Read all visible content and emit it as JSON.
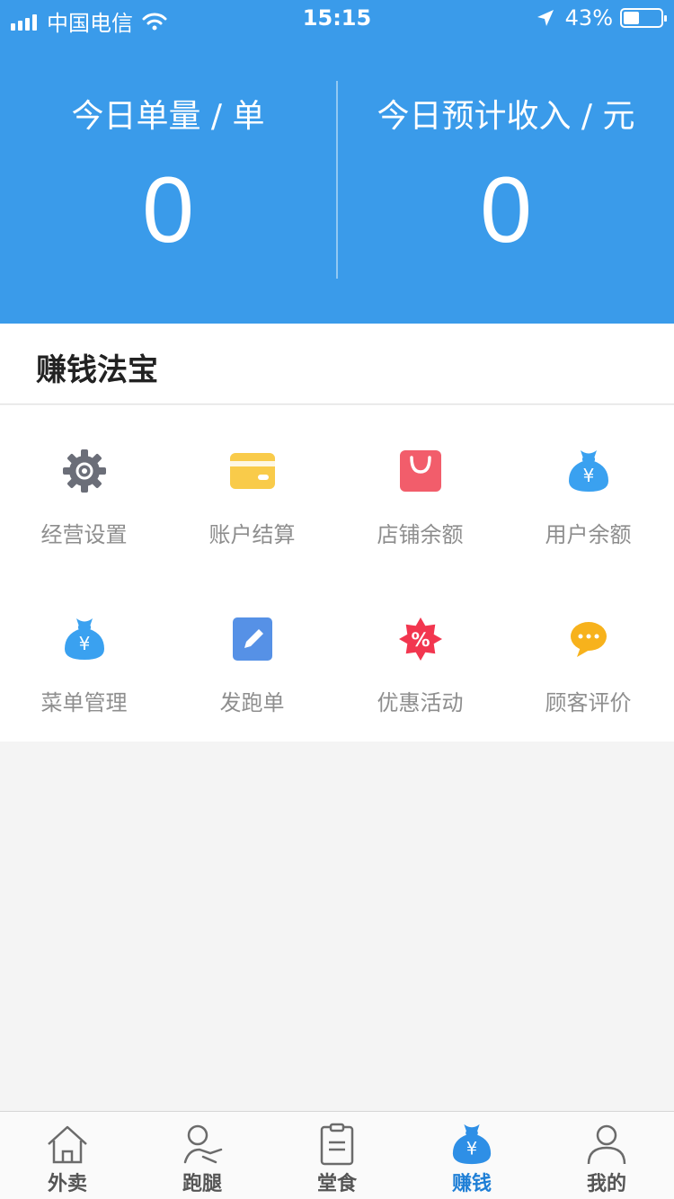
{
  "status_bar": {
    "carrier": "中国电信",
    "time": "15:15",
    "battery": "43%",
    "battery_level": 0.43
  },
  "hero": {
    "orders_label": "今日单量 / 单",
    "orders_value": "0",
    "income_label": "今日预计收入 / 元",
    "income_value": "0"
  },
  "section": {
    "title": "赚钱法宝"
  },
  "grid": {
    "items": [
      {
        "label": "经营设置",
        "icon": "gear-icon",
        "color": "#6b6e78"
      },
      {
        "label": "账户结算",
        "icon": "wallet-icon",
        "color": "#f9cb4a"
      },
      {
        "label": "店铺余额",
        "icon": "shopping-bag-icon",
        "color": "#f25d6b"
      },
      {
        "label": "用户余额",
        "icon": "money-bag-icon",
        "color": "#3aa1f0"
      },
      {
        "label": "菜单管理",
        "icon": "money-bag-icon",
        "color": "#3aa1f0"
      },
      {
        "label": "发跑单",
        "icon": "edit-icon",
        "color": "#5691e6"
      },
      {
        "label": "优惠活动",
        "icon": "discount-icon",
        "color": "#f2364f"
      },
      {
        "label": "顾客评价",
        "icon": "comment-icon",
        "color": "#f7b21c"
      }
    ]
  },
  "tabbar": {
    "active_color": "#1f7fd6",
    "tabs": [
      {
        "label": "外卖",
        "icon": "home-icon"
      },
      {
        "label": "跑腿",
        "icon": "runner-icon"
      },
      {
        "label": "堂食",
        "icon": "clipboard-icon"
      },
      {
        "label": "赚钱",
        "icon": "money-bag-icon",
        "active": true
      },
      {
        "label": "我的",
        "icon": "user-icon"
      }
    ]
  }
}
